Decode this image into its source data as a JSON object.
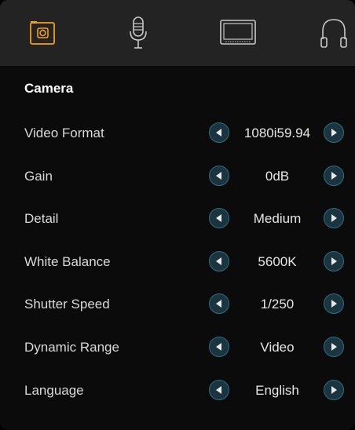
{
  "tabs": [
    {
      "name": "camera-tab",
      "icon": "camera-icon",
      "active": true
    },
    {
      "name": "audio-tab",
      "icon": "microphone-icon",
      "active": false
    },
    {
      "name": "display-tab",
      "icon": "monitor-icon",
      "active": false
    },
    {
      "name": "headphones-tab",
      "icon": "headphones-icon",
      "active": false
    }
  ],
  "colors": {
    "active_tab": "#f0a020",
    "inactive_tab": "#c8c8c8",
    "arrow_fill": "#1a3540",
    "arrow_ring": "#2f6d80"
  },
  "section": {
    "title": "Camera"
  },
  "settings": [
    {
      "label": "Video Format",
      "value": "1080i59.94"
    },
    {
      "label": "Gain",
      "value": "0dB"
    },
    {
      "label": "Detail",
      "value": "Medium"
    },
    {
      "label": "White Balance",
      "value": "5600K"
    },
    {
      "label": "Shutter Speed",
      "value": "1/250"
    },
    {
      "label": "Dynamic Range",
      "value": "Video"
    },
    {
      "label": "Language",
      "value": "English"
    }
  ]
}
